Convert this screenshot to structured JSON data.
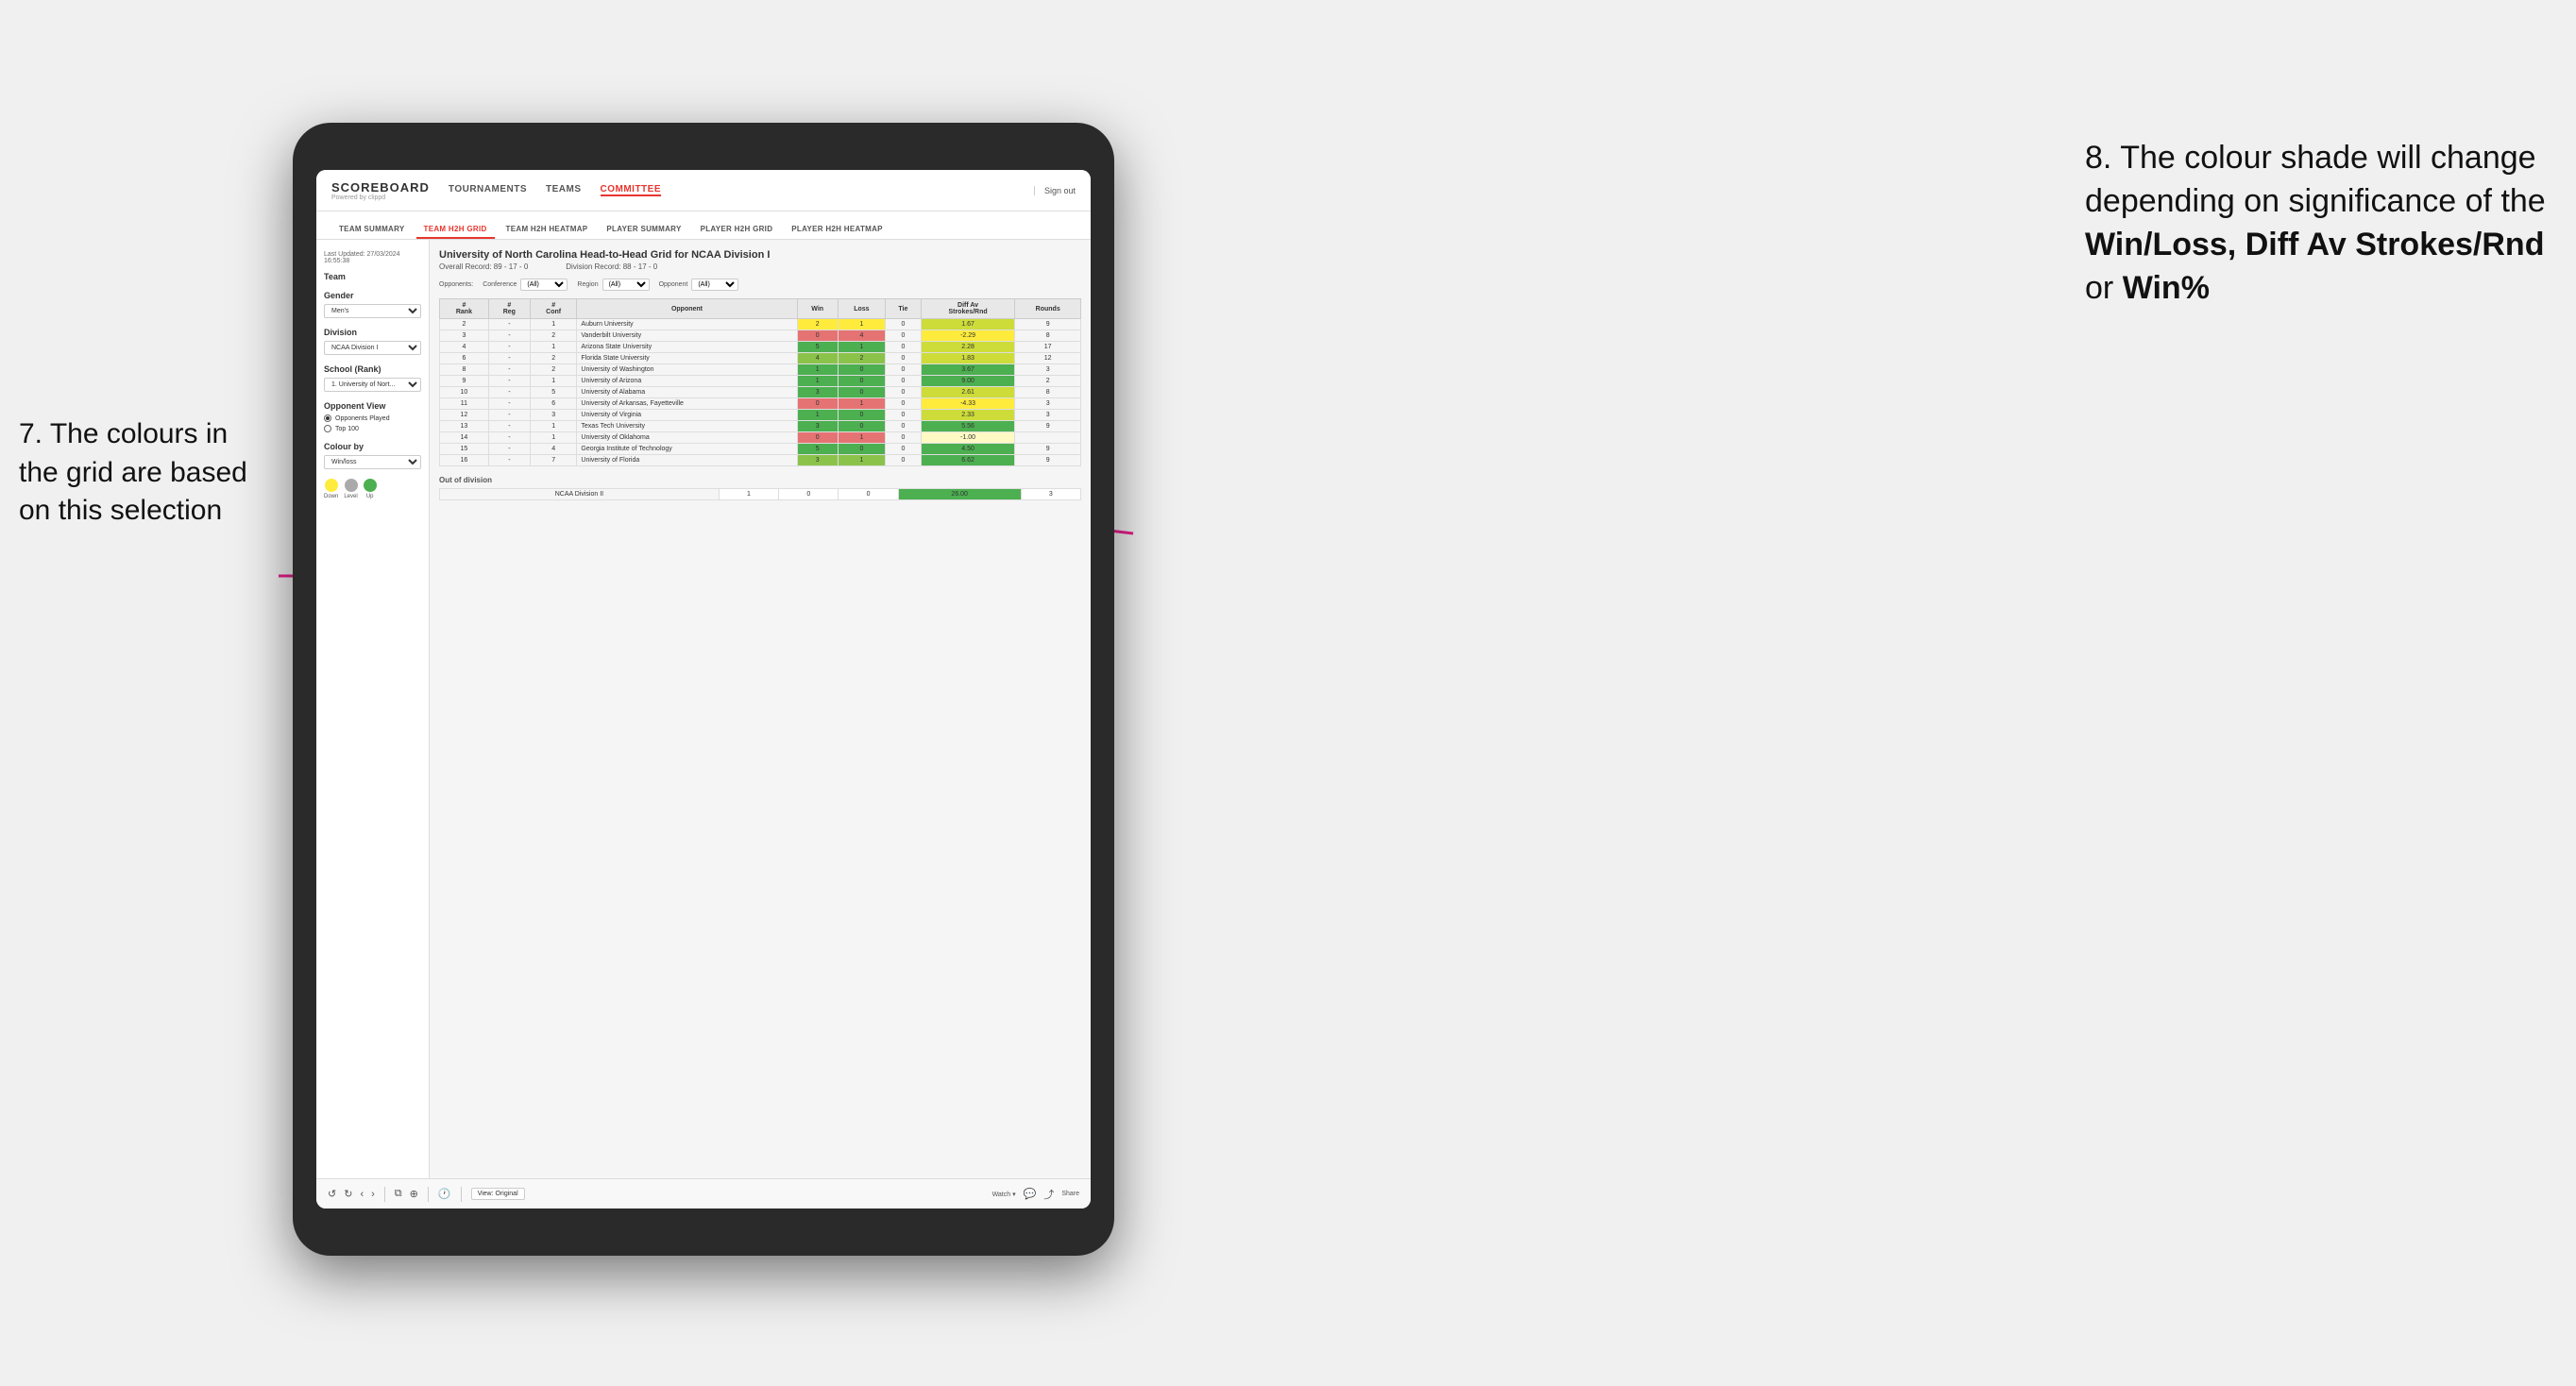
{
  "app": {
    "logo": "SCOREBOARD",
    "logo_sub": "Powered by clippd",
    "sign_out": "Sign out",
    "nav": [
      {
        "label": "TOURNAMENTS",
        "active": false
      },
      {
        "label": "TEAMS",
        "active": false
      },
      {
        "label": "COMMITTEE",
        "active": true
      }
    ],
    "sub_nav": [
      {
        "label": "TEAM SUMMARY",
        "active": false
      },
      {
        "label": "TEAM H2H GRID",
        "active": true
      },
      {
        "label": "TEAM H2H HEATMAP",
        "active": false
      },
      {
        "label": "PLAYER SUMMARY",
        "active": false
      },
      {
        "label": "PLAYER H2H GRID",
        "active": false
      },
      {
        "label": "PLAYER H2H HEATMAP",
        "active": false
      }
    ]
  },
  "sidebar": {
    "timestamp": "Last Updated: 27/03/2024 16:55:38",
    "team_label": "Team",
    "gender_label": "Gender",
    "gender_value": "Men's",
    "division_label": "Division",
    "division_value": "NCAA Division I",
    "school_label": "School (Rank)",
    "school_value": "1. University of Nort...",
    "opponent_view_label": "Opponent View",
    "radio_options": [
      {
        "label": "Opponents Played",
        "checked": true
      },
      {
        "label": "Top 100",
        "checked": false
      }
    ],
    "colour_by_label": "Colour by",
    "colour_by_value": "Win/loss",
    "legend": [
      {
        "label": "Down",
        "color": "#ffeb3b"
      },
      {
        "label": "Level",
        "color": "#aaaaaa"
      },
      {
        "label": "Up",
        "color": "#4caf50"
      }
    ]
  },
  "grid": {
    "title": "University of North Carolina Head-to-Head Grid for NCAA Division I",
    "overall_record": "Overall Record: 89 - 17 - 0",
    "division_record": "Division Record: 88 - 17 - 0",
    "filters": {
      "opponents_label": "Opponents:",
      "conference_label": "Conference",
      "conference_value": "(All)",
      "region_label": "Region",
      "region_value": "(All)",
      "opponent_label": "Opponent",
      "opponent_value": "(All)"
    },
    "columns": [
      "#\nRank",
      "# Reg",
      "# Conf",
      "Opponent",
      "Win",
      "Loss",
      "Tie",
      "Diff Av\nStrokes/Rnd",
      "Rounds"
    ],
    "rows": [
      {
        "rank": "2",
        "reg": "-",
        "conf": "1",
        "opponent": "Auburn University",
        "win": "2",
        "loss": "1",
        "tie": "0",
        "diff": "1.67",
        "rounds": "9",
        "win_color": "yellow",
        "diff_color": "green-light"
      },
      {
        "rank": "3",
        "reg": "-",
        "conf": "2",
        "opponent": "Vanderbilt University",
        "win": "0",
        "loss": "4",
        "tie": "0",
        "diff": "-2.29",
        "rounds": "8",
        "win_color": "red-mid",
        "diff_color": "yellow"
      },
      {
        "rank": "4",
        "reg": "-",
        "conf": "1",
        "opponent": "Arizona State University",
        "win": "5",
        "loss": "1",
        "tie": "0",
        "diff": "2.28",
        "rounds": "17",
        "win_color": "green-dark",
        "diff_color": "green-light"
      },
      {
        "rank": "6",
        "reg": "-",
        "conf": "2",
        "opponent": "Florida State University",
        "win": "4",
        "loss": "2",
        "tie": "0",
        "diff": "1.83",
        "rounds": "12",
        "win_color": "green-mid",
        "diff_color": "green-light"
      },
      {
        "rank": "8",
        "reg": "-",
        "conf": "2",
        "opponent": "University of Washington",
        "win": "1",
        "loss": "0",
        "tie": "0",
        "diff": "3.67",
        "rounds": "3",
        "win_color": "green-dark",
        "diff_color": "green-dark"
      },
      {
        "rank": "9",
        "reg": "-",
        "conf": "1",
        "opponent": "University of Arizona",
        "win": "1",
        "loss": "0",
        "tie": "0",
        "diff": "9.00",
        "rounds": "2",
        "win_color": "green-dark",
        "diff_color": "green-dark"
      },
      {
        "rank": "10",
        "reg": "-",
        "conf": "5",
        "opponent": "University of Alabama",
        "win": "3",
        "loss": "0",
        "tie": "0",
        "diff": "2.61",
        "rounds": "8",
        "win_color": "green-dark",
        "diff_color": "green-light"
      },
      {
        "rank": "11",
        "reg": "-",
        "conf": "6",
        "opponent": "University of Arkansas, Fayetteville",
        "win": "0",
        "loss": "1",
        "tie": "0",
        "diff": "-4.33",
        "rounds": "3",
        "win_color": "red-mid",
        "diff_color": "yellow"
      },
      {
        "rank": "12",
        "reg": "-",
        "conf": "3",
        "opponent": "University of Virginia",
        "win": "1",
        "loss": "0",
        "tie": "0",
        "diff": "2.33",
        "rounds": "3",
        "win_color": "green-dark",
        "diff_color": "green-light"
      },
      {
        "rank": "13",
        "reg": "-",
        "conf": "1",
        "opponent": "Texas Tech University",
        "win": "3",
        "loss": "0",
        "tie": "0",
        "diff": "5.56",
        "rounds": "9",
        "win_color": "green-dark",
        "diff_color": "green-dark"
      },
      {
        "rank": "14",
        "reg": "-",
        "conf": "1",
        "opponent": "University of Oklahoma",
        "win": "0",
        "loss": "1",
        "tie": "0",
        "diff": "-1.00",
        "rounds": "",
        "win_color": "red-mid",
        "diff_color": "yellow-light"
      },
      {
        "rank": "15",
        "reg": "-",
        "conf": "4",
        "opponent": "Georgia Institute of Technology",
        "win": "5",
        "loss": "0",
        "tie": "0",
        "diff": "4.50",
        "rounds": "9",
        "win_color": "green-dark",
        "diff_color": "green-dark"
      },
      {
        "rank": "16",
        "reg": "-",
        "conf": "7",
        "opponent": "University of Florida",
        "win": "3",
        "loss": "1",
        "tie": "0",
        "diff": "6.62",
        "rounds": "9",
        "win_color": "green-mid",
        "diff_color": "green-dark"
      }
    ],
    "out_of_division_label": "Out of division",
    "out_of_division_rows": [
      {
        "opponent": "NCAA Division II",
        "win": "1",
        "loss": "0",
        "tie": "0",
        "diff": "26.00",
        "rounds": "3",
        "diff_color": "green-dark"
      }
    ]
  },
  "toolbar": {
    "view_label": "View: Original",
    "watch_label": "Watch ▾",
    "share_label": "Share"
  },
  "annotations": {
    "left_text": "7. The colours in the grid are based on this selection",
    "right_title": "8. The colour shade will change depending on significance of the",
    "right_bold1": "Win/Loss,",
    "right_bold2": "Diff Av Strokes/Rnd",
    "right_bold3": "or",
    "right_bold4": "Win%"
  }
}
